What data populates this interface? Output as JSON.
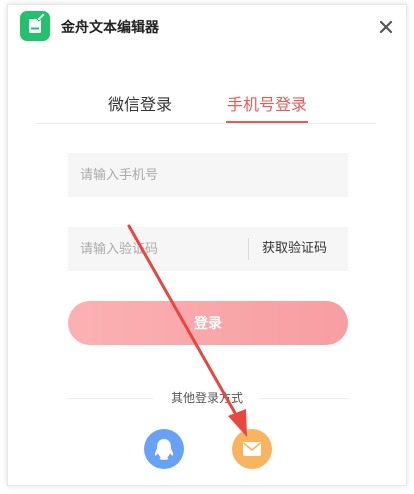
{
  "app": {
    "title": "金舟文本编辑器",
    "logo_icon": "note-edit-icon",
    "brand_color": "#21c16e"
  },
  "window": {
    "close_icon": "close-icon"
  },
  "tabs": [
    {
      "label": "微信登录",
      "active": false
    },
    {
      "label": "手机号登录",
      "active": true
    }
  ],
  "form": {
    "phone_placeholder": "请输入手机号",
    "phone_value": "",
    "code_placeholder": "请输入验证码",
    "code_value": "",
    "get_code_label": "获取验证码",
    "login_label": "登录"
  },
  "other_login": {
    "label": "其他登录方式",
    "options": [
      {
        "icon": "qq-icon",
        "color": "#69a1f7"
      },
      {
        "icon": "mail-icon",
        "color": "#f9b45f"
      }
    ]
  },
  "colors": {
    "accent": "#e85a5a",
    "login_button": "#f9a7aa",
    "annotation_arrow": "#e8463f"
  }
}
